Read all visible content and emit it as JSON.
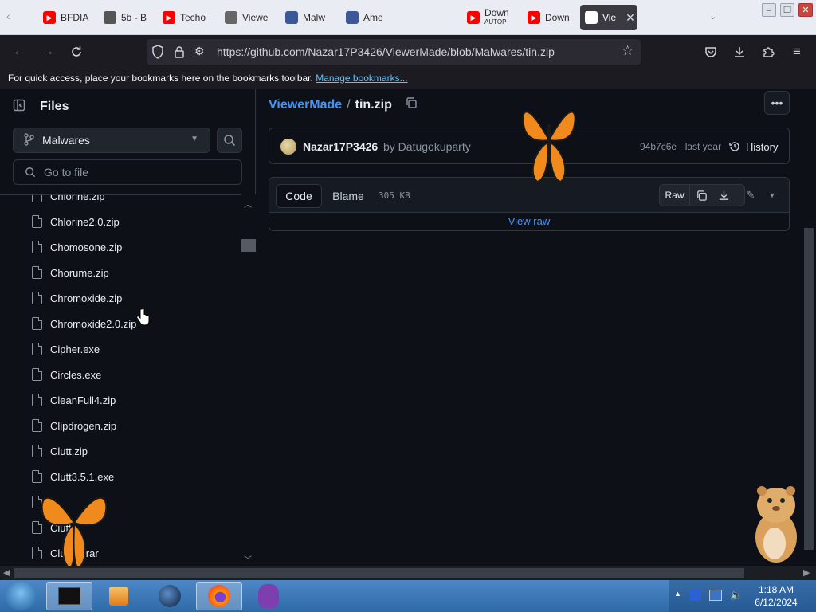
{
  "browser": {
    "tabs": [
      {
        "label": "BFDIA",
        "favicon": "youtube-icon",
        "color": "#ff0000"
      },
      {
        "label": "5b - B",
        "favicon": "page-icon",
        "color": "#555555"
      },
      {
        "label": "Techo",
        "favicon": "youtube-icon",
        "color": "#ff0000"
      },
      {
        "label": "Viewe",
        "favicon": "github-icon",
        "color": "#666666"
      },
      {
        "label": "Malw",
        "favicon": "page-icon",
        "color": "#3b5998"
      },
      {
        "label": "Ame",
        "favicon": "page-icon",
        "color": "#3b5998"
      },
      {
        "label": "Down",
        "sublabel": "AUTOP",
        "favicon": "youtube-icon",
        "color": "#ff0000"
      },
      {
        "label": "Down",
        "favicon": "youtube-icon",
        "color": "#ff0000"
      },
      {
        "label": "Vie",
        "favicon": "github-icon",
        "color": "#ffffff",
        "active": true
      }
    ],
    "url": "https://github.com/Nazar17P3426/ViewerMade/blob/Malwares/tin.zip",
    "bookmarks_bar": {
      "text": "For quick access, place your bookmarks here on the bookmarks toolbar.",
      "link": "Manage bookmarks..."
    }
  },
  "sidebar": {
    "title": "Files",
    "branch": "Malwares",
    "goto_placeholder": "Go to file",
    "files": [
      "Chlorine.zip",
      "Chlorine2.0.zip",
      "Chomosone.zip",
      "Chorume.zip",
      "Chromoxide.zip",
      "Chromoxide2.0.zip",
      "Cipher.exe",
      "Circles.exe",
      "CleanFull4.zip",
      "Clipdrogen.zip",
      "Clutt.zip",
      "Clutt3.5.1.exe",
      "",
      "Clutt",
      "Clu      .rar"
    ]
  },
  "main": {
    "repo": "ViewerMade",
    "separator": "/",
    "filename": "tin.zip",
    "commit": {
      "author": "Nazar17P3426",
      "coauthor": "by Datugokuparty",
      "sha_time": "94b7c6e · last year",
      "history_label": "History"
    },
    "file_view": {
      "code_tab": "Code",
      "blame_tab": "Blame",
      "size": "305 KB",
      "raw_label": "Raw",
      "view_raw": "View raw"
    }
  },
  "taskbar": {
    "time": "1:18 AM",
    "date": "6/12/2024"
  },
  "colors": {
    "accent_link": "#4493f8",
    "background": "#0d1117",
    "border": "#30363d"
  }
}
